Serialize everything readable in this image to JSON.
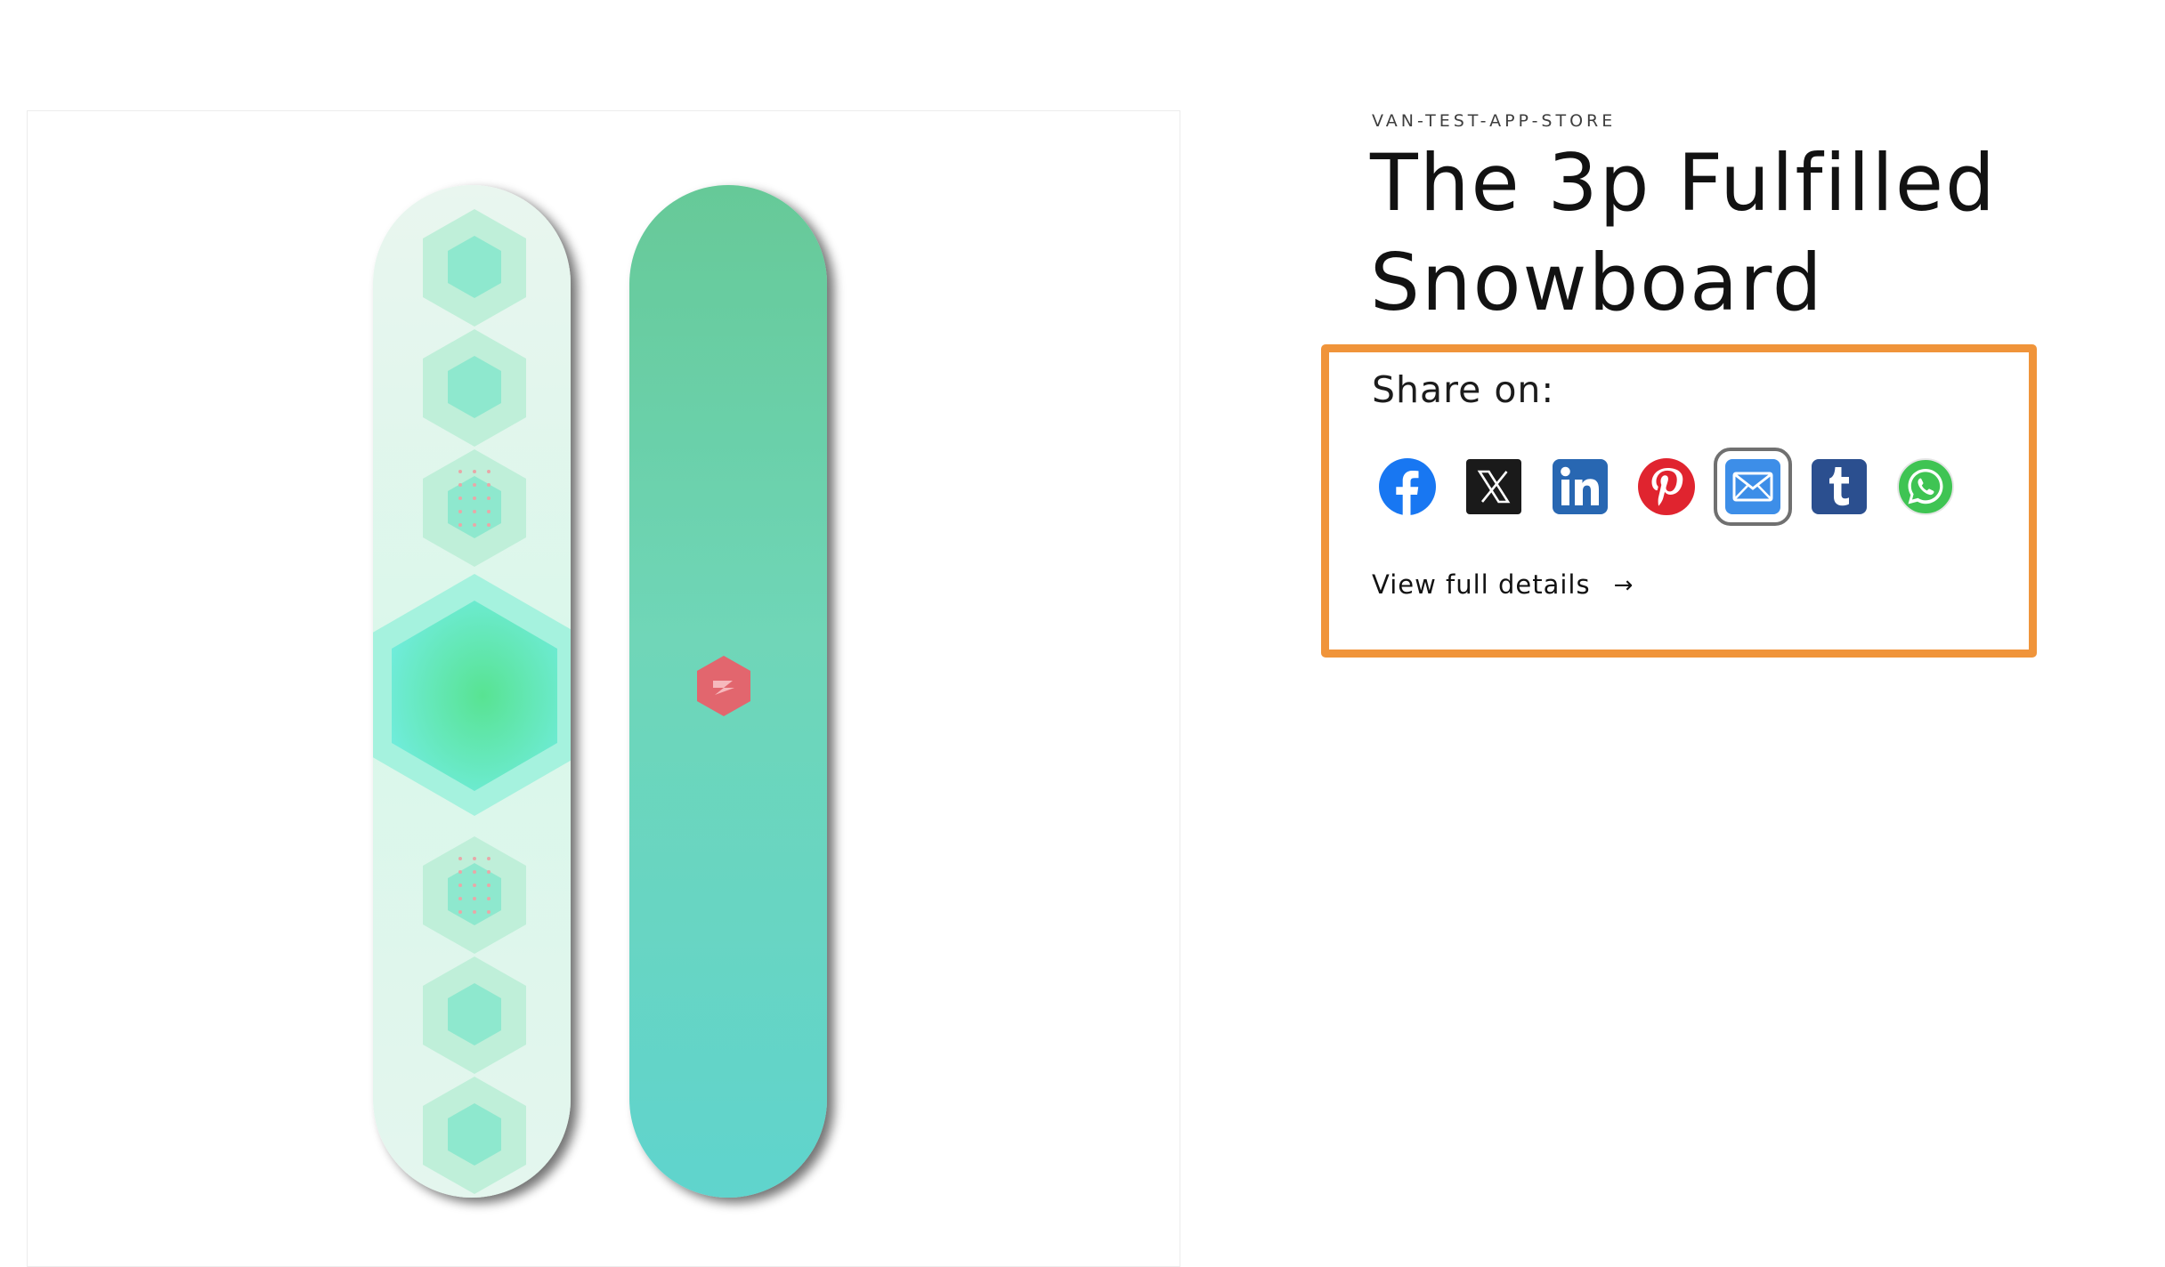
{
  "product": {
    "vendor": "VAN-TEST-APP-STORE",
    "title": "The 3p Fulfilled Snowboard",
    "image_alt": "Two mint-green snowboards shown top and bottom view"
  },
  "share": {
    "label": "Share on:",
    "buttons": [
      {
        "name": "Facebook",
        "icon": "facebook-icon",
        "color": "#1877f2"
      },
      {
        "name": "X",
        "icon": "x-icon",
        "color": "#1a1a1a"
      },
      {
        "name": "LinkedIn",
        "icon": "linkedin-icon",
        "color": "#2867b2"
      },
      {
        "name": "Pinterest",
        "icon": "pinterest-icon",
        "color": "#e0242f"
      },
      {
        "name": "Email",
        "icon": "email-icon",
        "color": "#3d8ee8",
        "focused": true
      },
      {
        "name": "Tumblr",
        "icon": "tumblr-icon",
        "color": "#2b4f8f"
      },
      {
        "name": "WhatsApp",
        "icon": "whatsapp-icon",
        "color": "#3fc453"
      }
    ]
  },
  "details_link": {
    "label": "View full details",
    "arrow": "→"
  },
  "colors": {
    "highlight_border": "#f0943a",
    "board_mint": "#66d4a6",
    "board_teal": "#5ed8cc",
    "logo_red": "#e2666e"
  }
}
